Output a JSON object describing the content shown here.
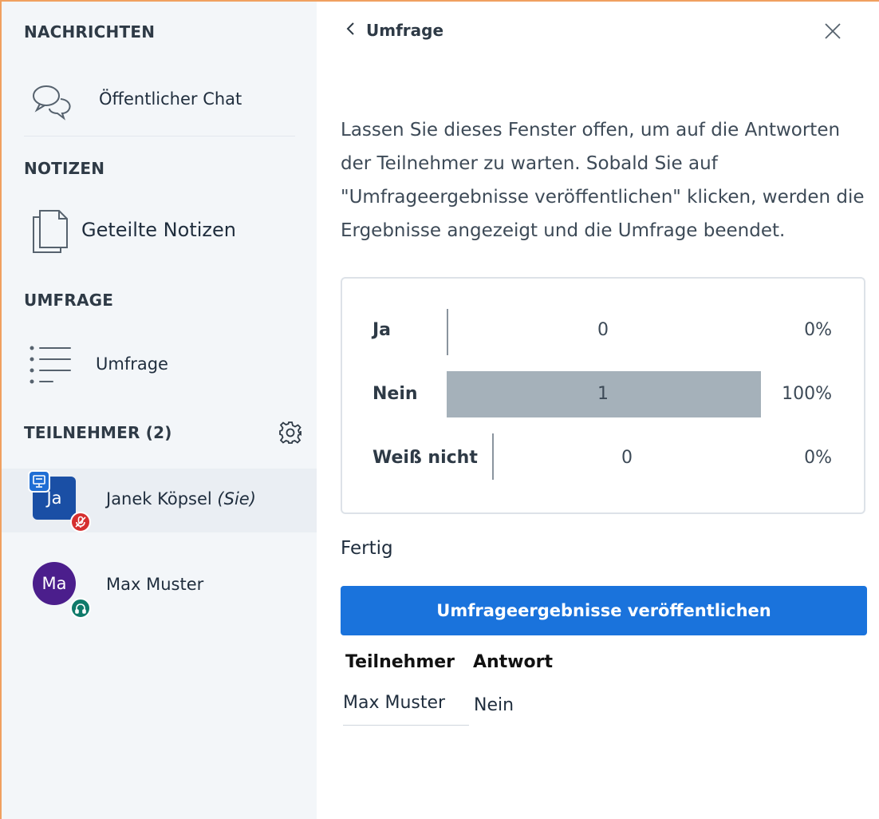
{
  "sidebar": {
    "messages": {
      "title": "NACHRICHTEN",
      "items": [
        {
          "label": "Öffentlicher Chat",
          "icon": "chat-icon"
        }
      ]
    },
    "notes": {
      "title": "NOTIZEN",
      "items": [
        {
          "label": "Geteilte Notizen",
          "icon": "document-icon"
        }
      ]
    },
    "poll": {
      "title": "UMFRAGE",
      "items": [
        {
          "label": "Umfrage",
          "icon": "list-icon"
        }
      ]
    },
    "participants": {
      "title": "TEILNEHMER (2)",
      "settings_icon": "gear-icon",
      "users": [
        {
          "initials": "Ja",
          "name": "Janek Köpsel",
          "suffix": "(Sie)",
          "avatar_color": "#1a4fa5",
          "status_icon": "muted-mic-icon",
          "status_color": "#d62f2f",
          "presenter": true
        },
        {
          "initials": "Ma",
          "name": "Max Muster",
          "avatar_color": "#4b1e8c",
          "status_icon": "headphones-icon",
          "status_color": "#0f7a6a",
          "presenter": false
        }
      ]
    }
  },
  "panel": {
    "back_label": "Umfrage",
    "instructions": "Lassen Sie dieses Fenster offen, um auf die Antworten der Teilnehmer zu warten. Sobald Sie auf \"Umfrageergebnisse veröffentlichen\" klicken, werden die Ergebnisse angezeigt und die Umfrage beendet.",
    "results": [
      {
        "label": "Ja",
        "count": "0",
        "percent": "0%",
        "fraction": 0
      },
      {
        "label": "Nein",
        "count": "1",
        "percent": "100%",
        "fraction": 1
      },
      {
        "label": "Weiß nicht",
        "count": "0",
        "percent": "0%",
        "fraction": 0
      }
    ],
    "status": "Fertig",
    "publish_button": "Umfrageergebnisse veröffentlichen",
    "table": {
      "headers": [
        "Teilnehmer",
        "Antwort"
      ],
      "rows": [
        [
          "Max Muster",
          "Nein"
        ]
      ]
    }
  },
  "colors": {
    "accent": "#1a73dc",
    "bar": "#a5b1ba",
    "sidebar_bg": "#f3f6f9",
    "frame": "#f0a060"
  }
}
